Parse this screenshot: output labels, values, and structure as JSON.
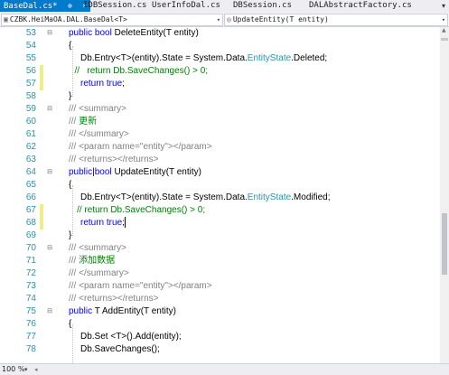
{
  "tabs": [
    {
      "label": "BaseDal.cs*",
      "pin": "⊕",
      "close": "×",
      "active": true
    },
    {
      "label": "IDBSession.cs",
      "active": false
    },
    {
      "label": "UserInfoDal.cs",
      "active": false
    },
    {
      "label": "DBSession.cs",
      "active": false
    },
    {
      "label": "DALAbstractFactory.cs",
      "active": false
    }
  ],
  "nav": {
    "project_icon": "▣",
    "project": "CZBK.HeiMaOA.DAL.BaseDal<T>",
    "member_icon": "◎",
    "member": "UpdateEntity(T entity)"
  },
  "lines": [
    {
      "n": "53",
      "fold": "⊟",
      "chg": "",
      "segs": [
        [
          "kw",
          "public "
        ],
        [
          "kw",
          "bool "
        ],
        [
          "tx",
          "DeleteEntity(T entity)"
        ]
      ],
      "indent": 1
    },
    {
      "n": "54",
      "fold": "",
      "chg": "",
      "segs": [
        [
          "tx",
          "{"
        ]
      ],
      "indent": 1
    },
    {
      "n": "55",
      "fold": "",
      "chg": "",
      "segs": [
        [
          "tx",
          "Db.Entry<T>(entity).State = System.Data."
        ],
        [
          "ty",
          "EntityState"
        ],
        [
          "tx",
          ".Deleted;"
        ]
      ],
      "indent": 2
    },
    {
      "n": "56",
      "fold": "",
      "chg": "yellow",
      "segs": [
        [
          "cm",
          "//   return Db.SaveChanges() > 0;"
        ]
      ],
      "indent": 1.5
    },
    {
      "n": "57",
      "fold": "",
      "chg": "yellow",
      "segs": [
        [
          "kw",
          "return "
        ],
        [
          "kw",
          "true"
        ],
        [
          "tx",
          ";"
        ]
      ],
      "indent": 2
    },
    {
      "n": "58",
      "fold": "",
      "chg": "",
      "segs": [
        [
          "tx",
          "}"
        ]
      ],
      "indent": 1
    },
    {
      "n": "59",
      "fold": "⊟",
      "chg": "",
      "segs": [
        [
          "xd",
          "/// <summary>"
        ]
      ],
      "indent": 1
    },
    {
      "n": "60",
      "fold": "",
      "chg": "",
      "segs": [
        [
          "xd",
          "/// "
        ],
        [
          "cm",
          "更新"
        ]
      ],
      "indent": 1
    },
    {
      "n": "61",
      "fold": "",
      "chg": "",
      "segs": [
        [
          "xd",
          "/// </summary>"
        ]
      ],
      "indent": 1
    },
    {
      "n": "62",
      "fold": "",
      "chg": "",
      "segs": [
        [
          "xd",
          "/// <param name=\"entity\"></param>"
        ]
      ],
      "indent": 1
    },
    {
      "n": "63",
      "fold": "",
      "chg": "",
      "segs": [
        [
          "xd",
          "/// <returns></returns>"
        ]
      ],
      "indent": 1
    },
    {
      "n": "64",
      "fold": "⊟",
      "chg": "",
      "segs": [
        [
          "kw",
          "public"
        ],
        [
          "tx",
          "|"
        ],
        [
          "kw",
          "bool "
        ],
        [
          "tx",
          "UpdateEntity(T entity)"
        ]
      ],
      "indent": 1
    },
    {
      "n": "65",
      "fold": "",
      "chg": "",
      "segs": [
        [
          "tx",
          "{"
        ]
      ],
      "indent": 1
    },
    {
      "n": "66",
      "fold": "",
      "chg": "",
      "segs": [
        [
          "tx",
          "Db.Entry<T>(entity).State = System.Data."
        ],
        [
          "ty",
          "EntityState"
        ],
        [
          "tx",
          ".Modified;"
        ]
      ],
      "indent": 2
    },
    {
      "n": "67",
      "fold": "",
      "chg": "yellow",
      "segs": [
        [
          "cm",
          "// return Db.SaveChanges() > 0;"
        ]
      ],
      "indent": 1.7
    },
    {
      "n": "68",
      "fold": "",
      "chg": "yellow",
      "segs": [
        [
          "kw",
          "return "
        ],
        [
          "kw",
          "true"
        ],
        [
          "tx",
          ";"
        ]
      ],
      "indent": 2,
      "caret": true
    },
    {
      "n": "69",
      "fold": "",
      "chg": "",
      "segs": [
        [
          "tx",
          "}"
        ]
      ],
      "indent": 1
    },
    {
      "n": "70",
      "fold": "⊟",
      "chg": "",
      "segs": [
        [
          "xd",
          "/// <summary>"
        ]
      ],
      "indent": 1
    },
    {
      "n": "71",
      "fold": "",
      "chg": "",
      "segs": [
        [
          "xd",
          "/// "
        ],
        [
          "cm",
          "添加数据"
        ]
      ],
      "indent": 1
    },
    {
      "n": "72",
      "fold": "",
      "chg": "",
      "segs": [
        [
          "xd",
          "/// </summary>"
        ]
      ],
      "indent": 1
    },
    {
      "n": "73",
      "fold": "",
      "chg": "",
      "segs": [
        [
          "xd",
          "/// <param name=\"entity\"></param>"
        ]
      ],
      "indent": 1
    },
    {
      "n": "74",
      "fold": "",
      "chg": "",
      "segs": [
        [
          "xd",
          "/// <returns></returns>"
        ]
      ],
      "indent": 1
    },
    {
      "n": "75",
      "fold": "⊟",
      "chg": "",
      "segs": [
        [
          "kw",
          "public "
        ],
        [
          "tx",
          "T AddEntity(T entity)"
        ]
      ],
      "indent": 1
    },
    {
      "n": "76",
      "fold": "",
      "chg": "",
      "segs": [
        [
          "tx",
          "{"
        ]
      ],
      "indent": 1
    },
    {
      "n": "77",
      "fold": "",
      "chg": "",
      "segs": [
        [
          "tx",
          "Db.Set <T>().Add(entity);"
        ]
      ],
      "indent": 2
    },
    {
      "n": "78",
      "fold": "",
      "chg": "",
      "segs": [
        [
          "tx",
          "Db.SaveChanges();"
        ]
      ],
      "indent": 2
    }
  ],
  "zoom": {
    "value": "100 %",
    "dropdown": "▾",
    "scroll_left": "◂"
  },
  "colors": {
    "accent": "#007acc",
    "keyword": "#0000ff",
    "comment": "#008000",
    "xmldoc": "#808080",
    "type": "#2b91af",
    "linenum": "#2b91af"
  }
}
